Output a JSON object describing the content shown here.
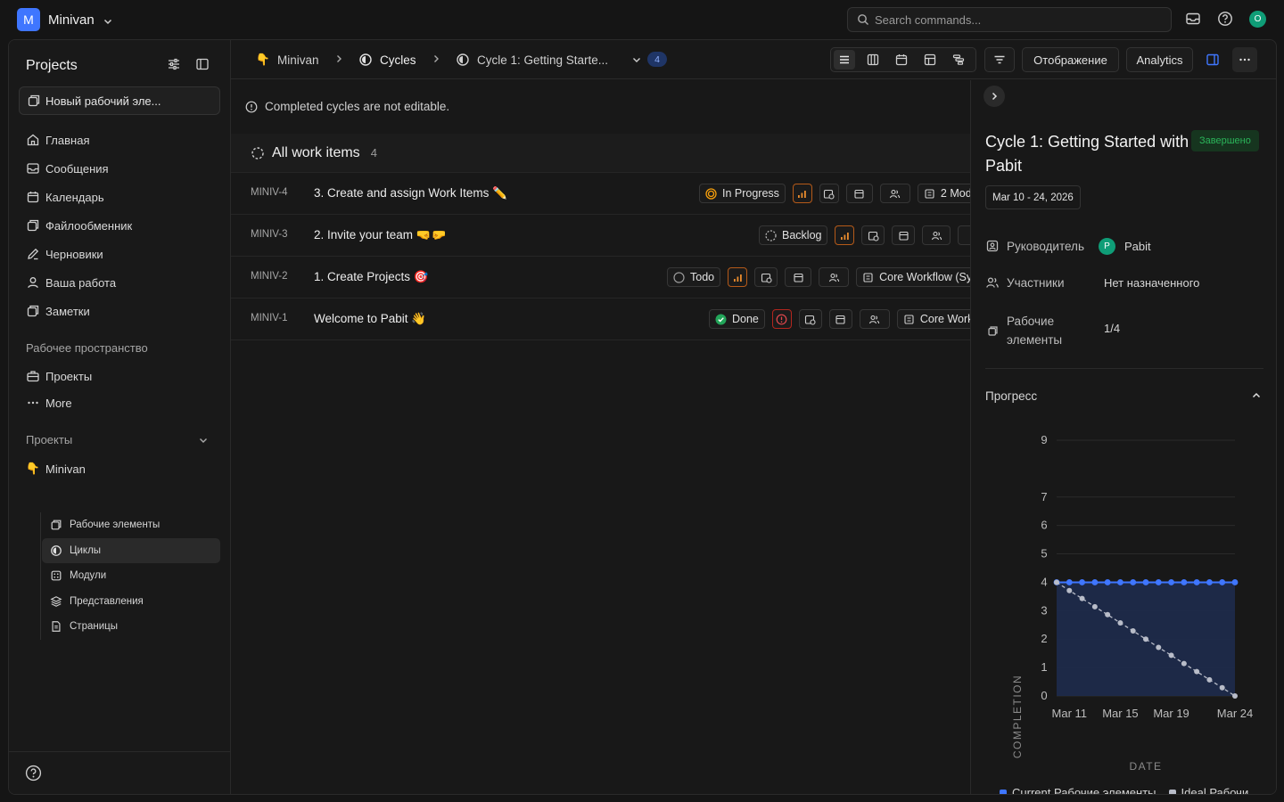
{
  "topbar": {
    "workspace_initial": "M",
    "workspace_name": "Minivan",
    "search_placeholder": "Search commands...",
    "user_initial": "O"
  },
  "sidebar": {
    "title": "Projects",
    "new_item_label": "Новый рабочий эле...",
    "main_nav": [
      {
        "label": "Главная",
        "icon": "home-icon"
      },
      {
        "label": "Сообщения",
        "icon": "inbox-icon"
      },
      {
        "label": "Календарь",
        "icon": "calendar-icon"
      },
      {
        "label": "Файлообменник",
        "icon": "file-share-icon"
      },
      {
        "label": "Черновики",
        "icon": "pen-icon"
      },
      {
        "label": "Ваша работа",
        "icon": "user-icon"
      },
      {
        "label": "Заметки",
        "icon": "notes-icon"
      }
    ],
    "workspace_section": "Рабочее пространство",
    "workspace_nav": [
      {
        "label": "Проекты",
        "icon": "briefcase-icon"
      },
      {
        "label": "More",
        "icon": "more-icon"
      }
    ],
    "projects_section": "Проекты",
    "project_name": "Minivan",
    "project_nav": [
      {
        "label": "Рабочие элементы",
        "icon": "work-items-icon",
        "active": false
      },
      {
        "label": "Циклы",
        "icon": "cycle-icon",
        "active": true
      },
      {
        "label": "Модули",
        "icon": "modules-icon",
        "active": false
      },
      {
        "label": "Представления",
        "icon": "views-icon",
        "active": false
      },
      {
        "label": "Страницы",
        "icon": "pages-icon",
        "active": false
      }
    ]
  },
  "header": {
    "crumb_project": "Minivan",
    "crumb_cycles": "Cycles",
    "crumb_cycle": "Cycle 1: Getting Starte...",
    "count": "4",
    "display_label": "Отображение",
    "analytics_label": "Analytics"
  },
  "content": {
    "notice": "Completed cycles are not editable.",
    "group_title": "All work items",
    "group_count": "4",
    "rows": [
      {
        "id": "MINIV-4",
        "name": "3. Create and assign Work Items ✏️",
        "state": "In Progress",
        "extra": "2 Mod"
      },
      {
        "id": "MINIV-3",
        "name": "2. Invite your team 🤜🤛",
        "state": "Backlog",
        "extra": ""
      },
      {
        "id": "MINIV-2",
        "name": "1. Create Projects 🎯",
        "state": "Todo",
        "extra": "Core Workflow (Sy"
      },
      {
        "id": "MINIV-1",
        "name": "Welcome to Pabit 👋",
        "state": "Done",
        "extra": "Core Work"
      }
    ]
  },
  "panel": {
    "title": "Cycle 1: Getting Started with Pabit",
    "status": "Завершено",
    "date_range": "Mar 10 - 24, 2026",
    "lead_label": "Руководитель",
    "lead_initial": "P",
    "lead_name": "Pabit",
    "members_label": "Участники",
    "members_value": "Нет назначенного",
    "items_label_1": "Рабочие",
    "items_label_2": "элементы",
    "items_value": "1/4",
    "progress_label": "Прогресс"
  },
  "chart_data": {
    "type": "line",
    "xlabel": "DATE",
    "ylabel": "COMPLETION",
    "x_ticks": [
      "Mar 11",
      "Mar 15",
      "Mar 19",
      "Mar 24"
    ],
    "y_ticks": [
      0,
      1,
      2,
      3,
      4,
      5,
      6,
      7,
      9
    ],
    "ylim": [
      0,
      9
    ],
    "x": [
      "Mar 10",
      "Mar 11",
      "Mar 12",
      "Mar 13",
      "Mar 14",
      "Mar 15",
      "Mar 16",
      "Mar 17",
      "Mar 18",
      "Mar 19",
      "Mar 20",
      "Mar 21",
      "Mar 22",
      "Mar 23",
      "Mar 24"
    ],
    "series": [
      {
        "name": "Current Рабочие элементы",
        "color": "#3f76ff",
        "values": [
          4,
          4,
          4,
          4,
          4,
          4,
          4,
          4,
          4,
          4,
          4,
          4,
          4,
          4,
          4
        ]
      },
      {
        "name": "Ideal Рабочие элементы",
        "color": "#b8bcc8",
        "values": [
          4,
          3.71,
          3.43,
          3.14,
          2.86,
          2.57,
          2.29,
          2,
          1.71,
          1.43,
          1.14,
          0.86,
          0.57,
          0.29,
          0
        ]
      }
    ],
    "legend_labels": [
      "Current Рабочие элементы",
      "Ideal Рабочи"
    ],
    "legend_position": "bottom"
  }
}
